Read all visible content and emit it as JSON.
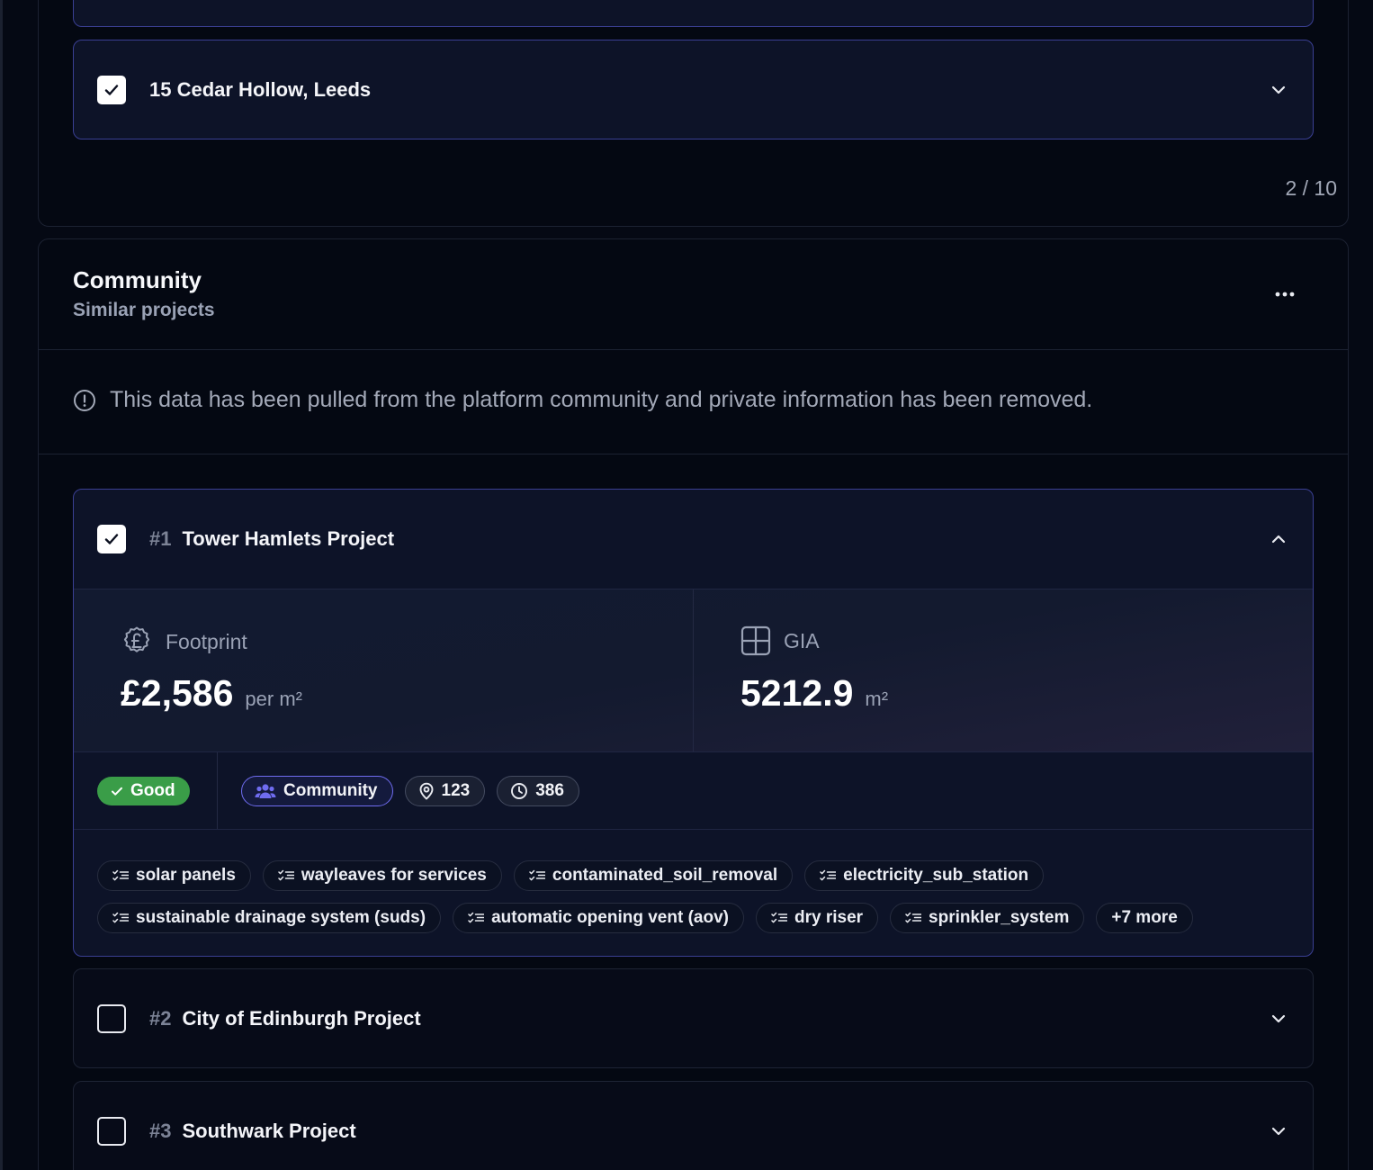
{
  "top_section": {
    "project": {
      "title": "15 Cedar Hollow, Leeds",
      "checked": true
    },
    "pager": "2 / 10"
  },
  "community": {
    "title": "Community",
    "subtitle": "Similar projects",
    "notice": "This data has been pulled from the platform community and private information has been removed.",
    "projects": [
      {
        "number": "#1",
        "title": "Tower Hamlets Project",
        "checked": true,
        "expanded": true,
        "stats": {
          "footprint": {
            "label": "Footprint",
            "value": "£2,586",
            "unit": "per m²"
          },
          "gia": {
            "label": "GIA",
            "value": "5212.9",
            "unit": "m²"
          }
        },
        "rating": "Good",
        "badges": {
          "source": "Community",
          "location": "123",
          "time": "386"
        },
        "tags": [
          "solar panels",
          "wayleaves for services",
          "contaminated_soil_removal",
          "electricity_sub_station",
          "sustainable drainage system (suds)",
          "automatic opening vent (aov)",
          "dry riser",
          "sprinkler_system"
        ],
        "more": "+7 more"
      },
      {
        "number": "#2",
        "title": "City of Edinburgh Project",
        "checked": false,
        "expanded": false
      },
      {
        "number": "#3",
        "title": "Southwark Project",
        "checked": false,
        "expanded": false
      }
    ]
  },
  "colors": {
    "accent_border": "#3a3f93",
    "good": "#3a9d48",
    "community_pill": "#6f6cf0"
  },
  "icons": [
    "check-icon",
    "chevron-down-icon",
    "chevron-up-icon",
    "more-icon",
    "info-icon",
    "pound-coin-icon",
    "grid-icon",
    "users-icon",
    "map-pin-icon",
    "clock-icon",
    "checklist-icon"
  ]
}
